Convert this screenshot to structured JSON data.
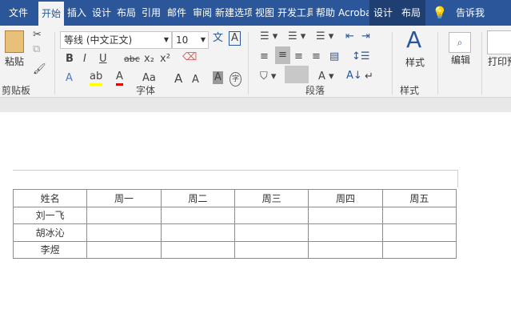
{
  "tabs": [
    "文件",
    "开始",
    "插入",
    "设计",
    "布局",
    "引用",
    "邮件",
    "审阅",
    "新建选项",
    "视图",
    "开发工具",
    "帮助",
    "Acrobat",
    "设计",
    "布局",
    "告诉我"
  ],
  "ribbon": {
    "paste": "粘贴",
    "clipboard": "剪贴板",
    "font_name": "等线 (中文正文)",
    "font_size": "10",
    "font_group": "字体",
    "bold": "B",
    "italic": "I",
    "underline": "U",
    "strike": "abc",
    "sub": "x₂",
    "sup": "x²",
    "change_case": "Aa",
    "grow": "A",
    "shrink": "A",
    "char_shade": "A",
    "enclose": "字",
    "phonetic": "文",
    "char_border": "A",
    "paragraph_group": "段落",
    "styles": "样式",
    "styles_group": "样式",
    "editing": "编辑",
    "print": "打印预"
  },
  "colors": {
    "tabbar": "#2b579a",
    "highlight": "#ffff00",
    "font_color": "#e00000"
  },
  "table": {
    "header": [
      "姓名",
      "周一",
      "周二",
      "周三",
      "周四",
      "周五"
    ],
    "rows": [
      [
        "刘一飞",
        "",
        "",
        "",
        "",
        ""
      ],
      [
        "胡冰沁",
        "",
        "",
        "",
        "",
        ""
      ],
      [
        "李煜",
        "",
        "",
        "",
        "",
        ""
      ]
    ]
  }
}
